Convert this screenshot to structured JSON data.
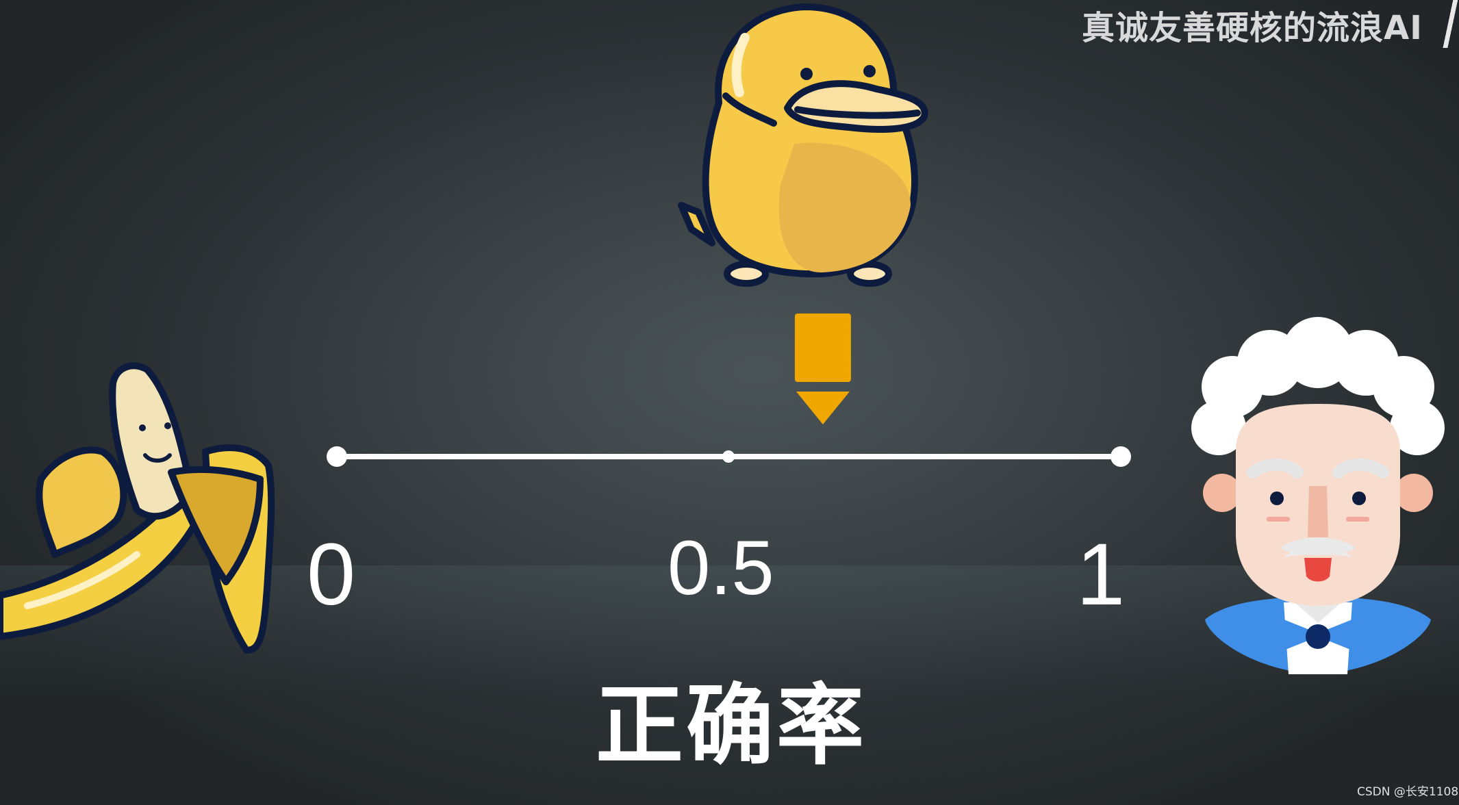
{
  "watermark": "真诚友善硬核的流浪AI",
  "scale": {
    "ticks": [
      "0",
      "0.5",
      "1"
    ],
    "marker_value": 0.62
  },
  "title": "正确率",
  "credit": "CSDN @长安1108",
  "colors": {
    "line": "#ffffff",
    "marker": "#f0a800",
    "outline": "#0d1b3e",
    "duck": "#f7c948",
    "banana": "#f5cf42",
    "coat": "#3f8fe8"
  },
  "icons": {
    "left": "banana-icon",
    "top": "platypus-icon",
    "right": "einstein-icon"
  }
}
